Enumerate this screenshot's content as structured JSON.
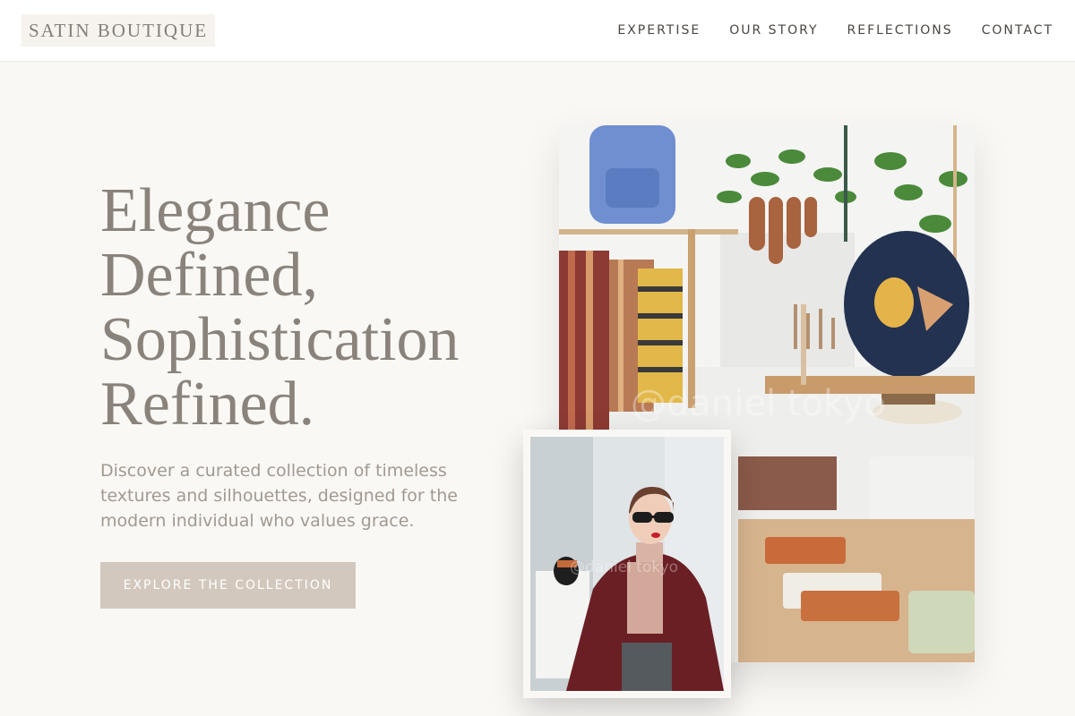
{
  "header": {
    "brand": "SATIN BOUTIQUE",
    "nav": [
      "EXPERTISE",
      "OUR STORY",
      "REFLECTIONS",
      "CONTACT"
    ]
  },
  "hero": {
    "title_lines": [
      "Elegance",
      "Defined,",
      "Sophistication",
      "Refined."
    ],
    "subtitle": "Discover a curated collection of timeless textures and silhouettes, designed for the modern individual who values grace.",
    "cta_label": "EXPLORE THE COLLECTION"
  },
  "images": {
    "main_watermark": "@daniel tokyo",
    "inset_watermark": "@daniel tokyo"
  },
  "colors": {
    "background": "#faf8f5",
    "title": "#8a837b",
    "cta": "#d2c8bd",
    "nav_text": "#4a4642"
  }
}
